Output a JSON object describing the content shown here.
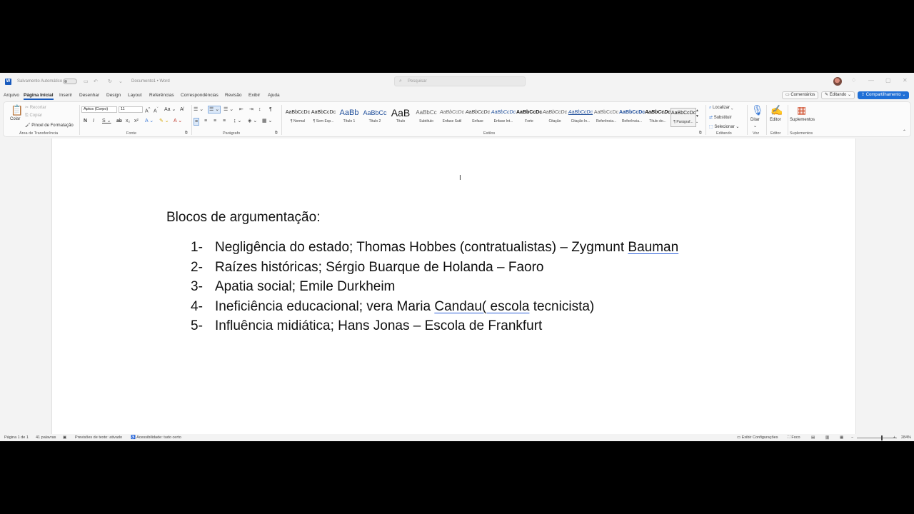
{
  "titlebar": {
    "autosave": "Salvamento Automático",
    "doc_title": "Documento1 • Word",
    "search_placeholder": "Pesquisar"
  },
  "menu": {
    "tabs": [
      "Arquivo",
      "Página Inicial",
      "Inserir",
      "Desenhar",
      "Design",
      "Layout",
      "Referências",
      "Correspondências",
      "Revisão",
      "Exibir",
      "Ajuda"
    ],
    "comments": "Comentários",
    "editing": "Editando",
    "share": "Compartilhamento"
  },
  "ribbon": {
    "clipboard": {
      "paste": "Colar",
      "undo": "Recortar",
      "copy": "Copiar",
      "format_painter": "Pincel de Formatação",
      "label": "Área de Transferência"
    },
    "font": {
      "name": "Aptos (Corpo)",
      "size": "11",
      "label": "Fonte"
    },
    "paragraph": {
      "label": "Parágrafo"
    },
    "styles": {
      "items": [
        {
          "preview": "AaBbCcDc",
          "name": "¶ Normal"
        },
        {
          "preview": "AaBbCcDc",
          "name": "¶ Sem Esp..."
        },
        {
          "preview": "AaBb",
          "name": "Título 1"
        },
        {
          "preview": "AaBbCc",
          "name": "Título 2"
        },
        {
          "preview": "AaB",
          "name": "Título"
        },
        {
          "preview": "AaBbCc",
          "name": "Subtítulo"
        },
        {
          "preview": "AaBbCcDc",
          "name": "Ênfase Sutil"
        },
        {
          "preview": "AaBbCcDc",
          "name": "Ênfase"
        },
        {
          "preview": "AaBbCcDc",
          "name": "Ênfase Int..."
        },
        {
          "preview": "AaBbCcDc",
          "name": "Forte"
        },
        {
          "preview": "AaBbCcDc",
          "name": "Citação"
        },
        {
          "preview": "AaBbCcDc",
          "name": "Citação In..."
        },
        {
          "preview": "AaBbCcDc",
          "name": "Referência..."
        },
        {
          "preview": "AaBbCcDc",
          "name": "Referência..."
        },
        {
          "preview": "AaBbCcDc",
          "name": "Título do..."
        },
        {
          "preview": "AaBbCcDc",
          "name": "¶ Parágraf..."
        }
      ],
      "label": "Estilos"
    },
    "editing": {
      "find": "Localizar",
      "replace": "Substituir",
      "select": "Selecionar",
      "label": "Editando"
    },
    "voice": {
      "dictate": "Ditar",
      "label": "Voz"
    },
    "editor": {
      "name": "Editor",
      "label": "Editor"
    },
    "addins": {
      "name": "Suplementos",
      "label": "Suplementos"
    }
  },
  "document": {
    "heading": "Blocos de argumentação:",
    "items": [
      {
        "num": "1-",
        "text_a": "Negligência do estado; Thomas Hobbes (contratualistas) – Zygmunt ",
        "text_b": "Bauman",
        "text_c": ""
      },
      {
        "num": "2-",
        "text_a": "Raízes históricas; Sérgio Buarque de Holanda – Faoro",
        "text_b": "",
        "text_c": ""
      },
      {
        "num": "3-",
        "text_a": "Apatia social; Emile Durkheim",
        "text_b": "",
        "text_c": ""
      },
      {
        "num": "4-",
        "text_a": "Ineficiência educacional; vera Maria ",
        "text_b": "Candau( escola",
        "text_c": " tecnicista)"
      },
      {
        "num": "5-",
        "text_a": "Influência midiática; Hans Jonas – Escola de Frankfurt",
        "text_b": "",
        "text_c": ""
      }
    ]
  },
  "status": {
    "page": "Página 1 de 1",
    "words": "41 palavras",
    "predictions": "Previsões de texto: ativado",
    "accessibility": "Acessibilidade: tudo certo",
    "display_settings": "Exibir Configurações",
    "focus": "Foco",
    "zoom": "284%"
  },
  "colors": {
    "accent": "#185abd",
    "share": "#1f6fd6"
  }
}
